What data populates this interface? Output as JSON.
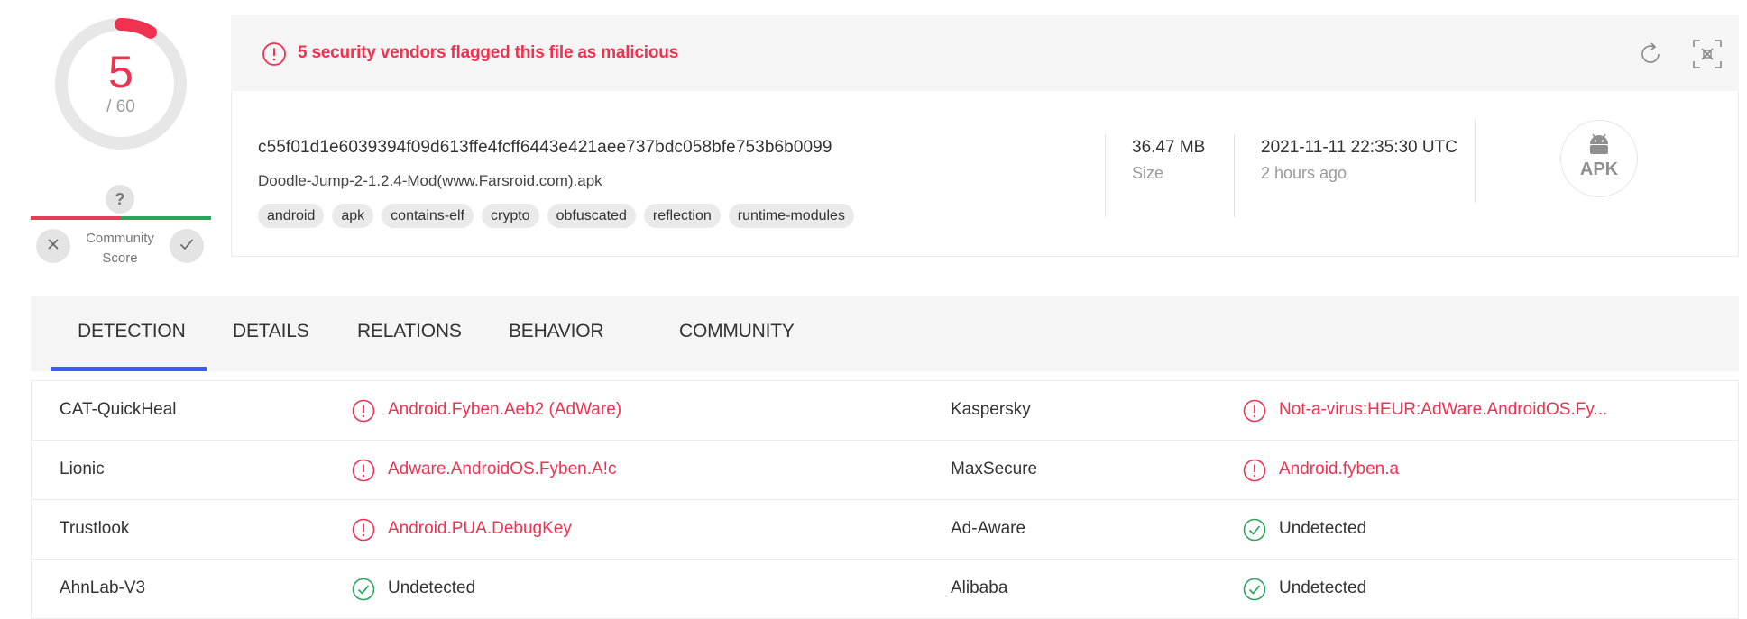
{
  "score": {
    "detected": "5",
    "total": "/ 60",
    "detected_count": 5,
    "total_count": 60,
    "community_question": "?",
    "community_label": "Community Score"
  },
  "alert": {
    "text": "5 security vendors flagged this file as malicious"
  },
  "file": {
    "hash": "c55f01d1e6039394f09d613ffe4fcff6443e421aee737bdc058bfe753b6b0099",
    "name": "Doodle-Jump-2-1.2.4-Mod(www.Farsroid.com).apk",
    "tags": [
      "android",
      "apk",
      "contains-elf",
      "crypto",
      "obfuscated",
      "reflection",
      "runtime-modules"
    ],
    "size_value": "36.47 MB",
    "size_label": "Size",
    "date_value": "2021-11-11 22:35:30 UTC",
    "date_relative": "2 hours ago",
    "type_badge": "APK"
  },
  "tabs": [
    "DETECTION",
    "DETAILS",
    "RELATIONS",
    "BEHAVIOR",
    "COMMUNITY"
  ],
  "detections": [
    {
      "left": {
        "vendor": "CAT-QuickHeal",
        "result": "Android.Fyben.Aeb2 (AdWare)",
        "status": "malicious"
      },
      "right": {
        "vendor": "Kaspersky",
        "result": "Not-a-virus:HEUR:AdWare.AndroidOS.Fy...",
        "status": "malicious"
      }
    },
    {
      "left": {
        "vendor": "Lionic",
        "result": "Adware.AndroidOS.Fyben.A!c",
        "status": "malicious"
      },
      "right": {
        "vendor": "MaxSecure",
        "result": "Android.fyben.a",
        "status": "malicious"
      }
    },
    {
      "left": {
        "vendor": "Trustlook",
        "result": "Android.PUA.DebugKey",
        "status": "malicious"
      },
      "right": {
        "vendor": "Ad-Aware",
        "result": "Undetected",
        "status": "clean"
      }
    },
    {
      "left": {
        "vendor": "AhnLab-V3",
        "result": "Undetected",
        "status": "clean"
      },
      "right": {
        "vendor": "Alibaba",
        "result": "Undetected",
        "status": "clean"
      }
    }
  ],
  "colors": {
    "malicious": "#f0314f",
    "clean": "#2ba55b",
    "accent": "#3d5afe",
    "panel": "#f5f5f5"
  }
}
